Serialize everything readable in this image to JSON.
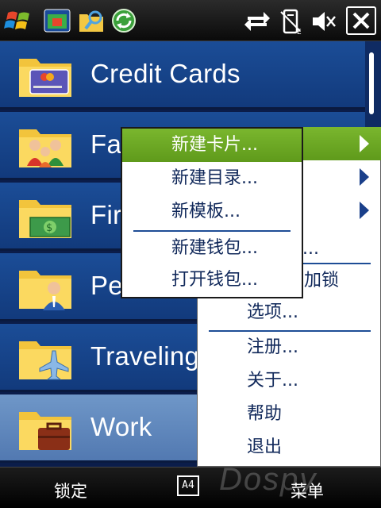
{
  "status_bar": {
    "icons": [
      "windows-start-icon",
      "wallet-app-icon",
      "file-explorer-icon",
      "sync-icon",
      "connectivity-icon",
      "phone-signal-icon",
      "volume-icon",
      "close-icon"
    ]
  },
  "list": {
    "items": [
      {
        "label": "Credit Cards",
        "icon": "credit-card-folder-icon"
      },
      {
        "label": "Fa",
        "icon": "family-folder-icon"
      },
      {
        "label": "Fir",
        "icon": "finance-folder-icon"
      },
      {
        "label": "Personal",
        "icon": "personal-folder-icon"
      },
      {
        "label": "Traveling",
        "icon": "travel-folder-icon"
      },
      {
        "label": "Work",
        "icon": "work-folder-icon"
      }
    ],
    "selected_index": 5
  },
  "menu": {
    "items": [
      "新建卡片...",
      "新建目录...",
      "新模板...",
      "新建钱包...",
      "打开钱包...",
      "加锁",
      "选项...",
      "注册...",
      "关于...",
      "帮助",
      "退出"
    ],
    "partial": {
      "new_wallet_tail": "..."
    }
  },
  "submenu": {
    "items": [
      "新建卡片...",
      "新建目录...",
      "新模板...",
      "新建钱包...",
      "打开钱包..."
    ],
    "highlighted": 0
  },
  "softkeys": {
    "left": "锁定",
    "right": "菜单",
    "ime": "A4"
  },
  "watermark": "Dospy",
  "colors": {
    "list_bg": "#1b4d97",
    "selected_bg": "#6f97c8",
    "highlight": "#7ab62e",
    "menu_text": "#10285a"
  }
}
